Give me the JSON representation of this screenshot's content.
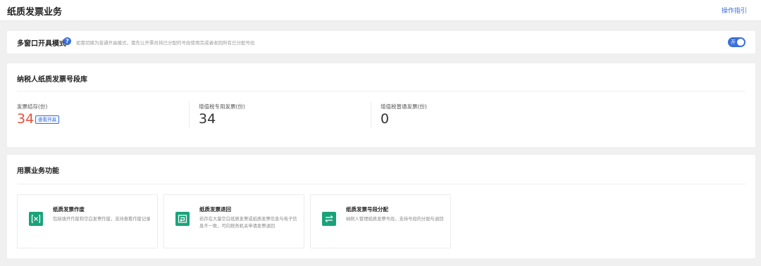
{
  "header": {
    "title": "纸质发票业务",
    "guide_link": "操作指引"
  },
  "mode": {
    "title": "多窗口开具模式",
    "description": "如需切换为普通开具模式，需先让开票员将已分配的号段使用完或者收回所有已分配号段",
    "toggle_label": "开",
    "toggle_on": true
  },
  "inventory": {
    "title": "纳税人纸质发票号段库",
    "stats": [
      {
        "label": "发票结存(份)",
        "value": "34",
        "action": "查看开具",
        "color": "#e4513a"
      },
      {
        "label": "增值税专用发票(份)",
        "value": "34"
      },
      {
        "label": "增值税普通发票(份)",
        "value": "0"
      }
    ]
  },
  "functions": {
    "title": "用票业务功能",
    "items": [
      {
        "title": "纸质发票作废",
        "description": "包括填开作废和空白发票作废，支持查看作废记录",
        "icon": "void-invoice-icon"
      },
      {
        "title": "纸质发票退回",
        "description": "若存在大量空白纸质发票或纸质发票信息与电子信息不一致，可向税务机关申请发票退回",
        "icon": "return-invoice-icon"
      },
      {
        "title": "纸质发票号段分配",
        "description": "纳税人管理纸质发票号段，支持号段的分配与退回",
        "icon": "swap-arrows-icon"
      }
    ]
  },
  "colors": {
    "accent": "#3b6fd8",
    "green": "#1aa37a",
    "red": "#e4513a"
  }
}
